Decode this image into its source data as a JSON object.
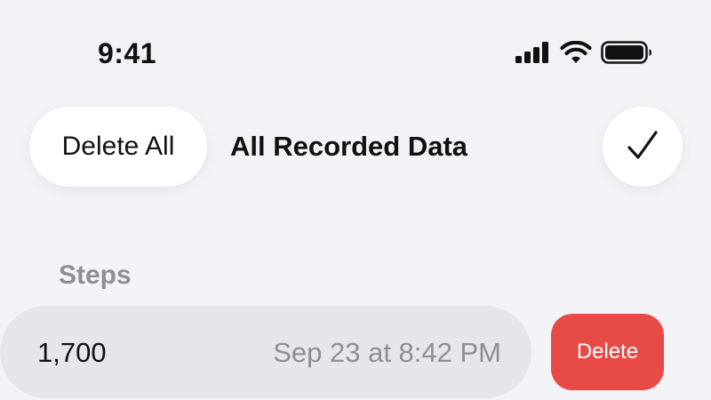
{
  "status_bar": {
    "time": "9:41",
    "icons": [
      "cellular-signal-icon",
      "wifi-icon",
      "battery-icon"
    ]
  },
  "header": {
    "delete_all_label": "Delete All",
    "title": "All Recorded Data",
    "done_icon": "checkmark-icon"
  },
  "section": {
    "title": "Steps",
    "rows": [
      {
        "value": "1,700",
        "date": "Sep 23 at 8:42 PM",
        "delete_label": "Delete"
      }
    ]
  },
  "colors": {
    "background": "#f2f2f7",
    "destructive": "#e84a46",
    "secondary_text": "#8e8e93",
    "row_background": "#e5e5ea"
  }
}
